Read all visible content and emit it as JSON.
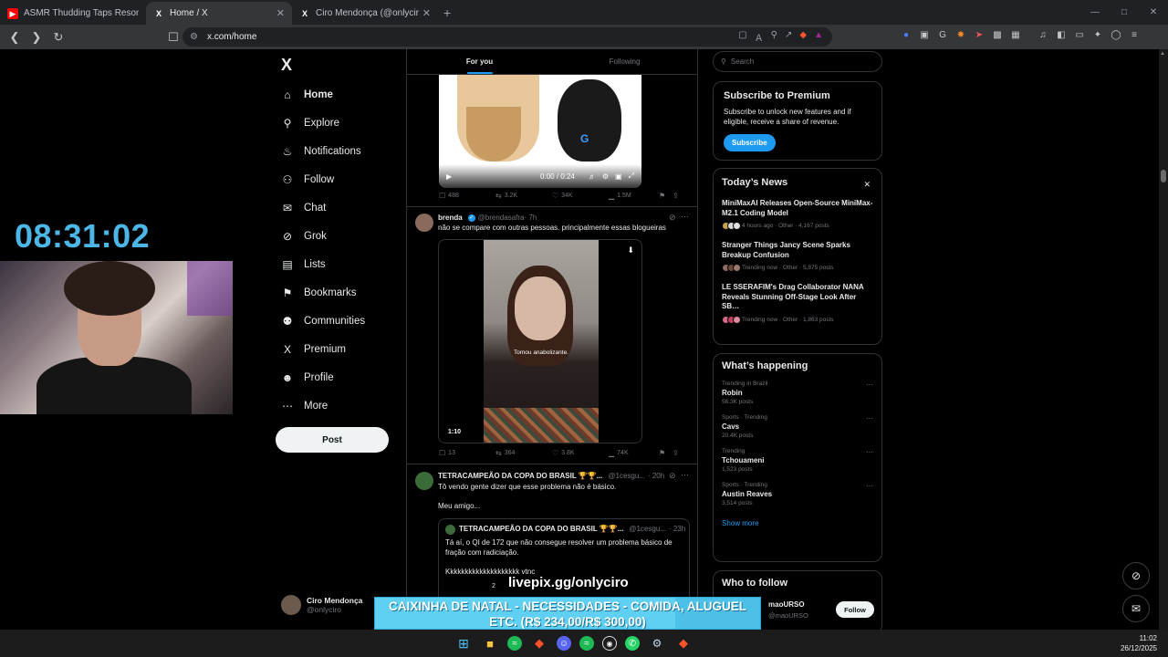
{
  "browser": {
    "tabs": [
      {
        "title": "ASMR Thudding Taps Resonating in …",
        "icon": "youtube-icon",
        "color": "#ff0000"
      },
      {
        "title": "Home / X",
        "icon": "x-icon",
        "color": "#000000"
      },
      {
        "title": "Ciro Mendonça (@onlyciro) / X",
        "icon": "x-icon",
        "color": "#000000"
      }
    ],
    "url": "x.com/home"
  },
  "overlay": {
    "clock": "08:31:02",
    "livepix": "livepix.gg/onlyciro",
    "goal_text": "CAIXINHA DE NATAL - NECESSIDADES - COMIDA, ALUGUEL ETC. (R$ 234,00/R$ 300,00)",
    "goal_progress": 0.78
  },
  "nav": {
    "items": [
      {
        "label": "Home",
        "icon": "home-icon"
      },
      {
        "label": "Explore",
        "icon": "search-icon"
      },
      {
        "label": "Notifications",
        "icon": "bell-icon"
      },
      {
        "label": "Follow",
        "icon": "person-plus-icon"
      },
      {
        "label": "Chat",
        "icon": "mail-icon"
      },
      {
        "label": "Grok",
        "icon": "grok-icon"
      },
      {
        "label": "Lists",
        "icon": "list-icon"
      },
      {
        "label": "Bookmarks",
        "icon": "bookmark-icon"
      },
      {
        "label": "Communities",
        "icon": "communities-icon"
      },
      {
        "label": "Premium",
        "icon": "x-icon"
      },
      {
        "label": "Profile",
        "icon": "person-icon"
      },
      {
        "label": "More",
        "icon": "more-circle-icon"
      }
    ],
    "post_label": "Post",
    "account": {
      "name": "Ciro Mendonça",
      "handle": "@onlyciro"
    }
  },
  "timeline": {
    "tabs": [
      "For you",
      "Following"
    ],
    "tweet1": {
      "video_time": "0:00 / 0:24",
      "replies": "488",
      "reposts": "3.2K",
      "likes": "34K",
      "views": "1.5M"
    },
    "tweet2": {
      "name": "brenda",
      "handle": "@brendasafra",
      "time": "· 7h",
      "text": "não se compare com outras pessoas. principalmente essas blogueiras",
      "subtitle": "Tomou anabolizante.",
      "duration": "1:10",
      "replies": "13",
      "reposts": "364",
      "likes": "3.8K",
      "views": "74K"
    },
    "tweet3": {
      "name": "TETRACAMPEÃO DA COPA DO BRASIL 🏆🏆...",
      "handle": "@1cesgu...",
      "time": "· 20h",
      "text1": "Tô vendo gente dizer que esse problema não é básico.",
      "text2": "Meu amigo...",
      "quote": {
        "name": "TETRACAMPEÃO DA COPA DO BRASIL 🏆🏆...",
        "handle": "@1cesgu...",
        "time": "· 23h",
        "text": "Tá aí, o QI de 172 que não consegue resolver um problema básico de fração com radiciação.",
        "text2": "Kkkkkkkkkkkkkkkkkkkk vtnc",
        "extra": "2"
      }
    }
  },
  "sidebar": {
    "search_placeholder": "Search",
    "premium": {
      "title": "Subscribe to Premium",
      "text": "Subscribe to unlock new features and if eligible, receive a share of revenue.",
      "button": "Subscribe"
    },
    "news": {
      "title": "Today’s News",
      "items": [
        {
          "title": "MiniMaxAI Releases Open-Source MiniMax-M2.1 Coding Model",
          "meta": "4 hours ago · Other · 4,167 posts"
        },
        {
          "title": "Stranger Things Jancy Scene Sparks Breakup Confusion",
          "meta": "Trending now · Other · 5,875 posts"
        },
        {
          "title": "LE SSERAFIM's Drag Collaborator NANA Reveals Stunning Off-Stage Look After SB…",
          "meta": "Trending now · Other · 1,863 posts"
        }
      ]
    },
    "happening": {
      "title": "What’s happening",
      "items": [
        {
          "context": "Trending in Brazil",
          "name": "Robin",
          "posts": "56.3K posts"
        },
        {
          "context": "Sports · Trending",
          "name": "Cavs",
          "posts": "20.4K posts"
        },
        {
          "context": "Trending",
          "name": "Tchouameni",
          "posts": "1,523 posts"
        },
        {
          "context": "Sports · Trending",
          "name": "Austin Reaves",
          "posts": "3,514 posts"
        }
      ],
      "show_more": "Show more"
    },
    "who_to_follow": {
      "title": "Who to follow",
      "name": "maoURSO",
      "handle": "@maoURSO",
      "button": "Follow"
    }
  },
  "taskbar": {
    "time": "11:02",
    "date": "26/12/2025"
  }
}
